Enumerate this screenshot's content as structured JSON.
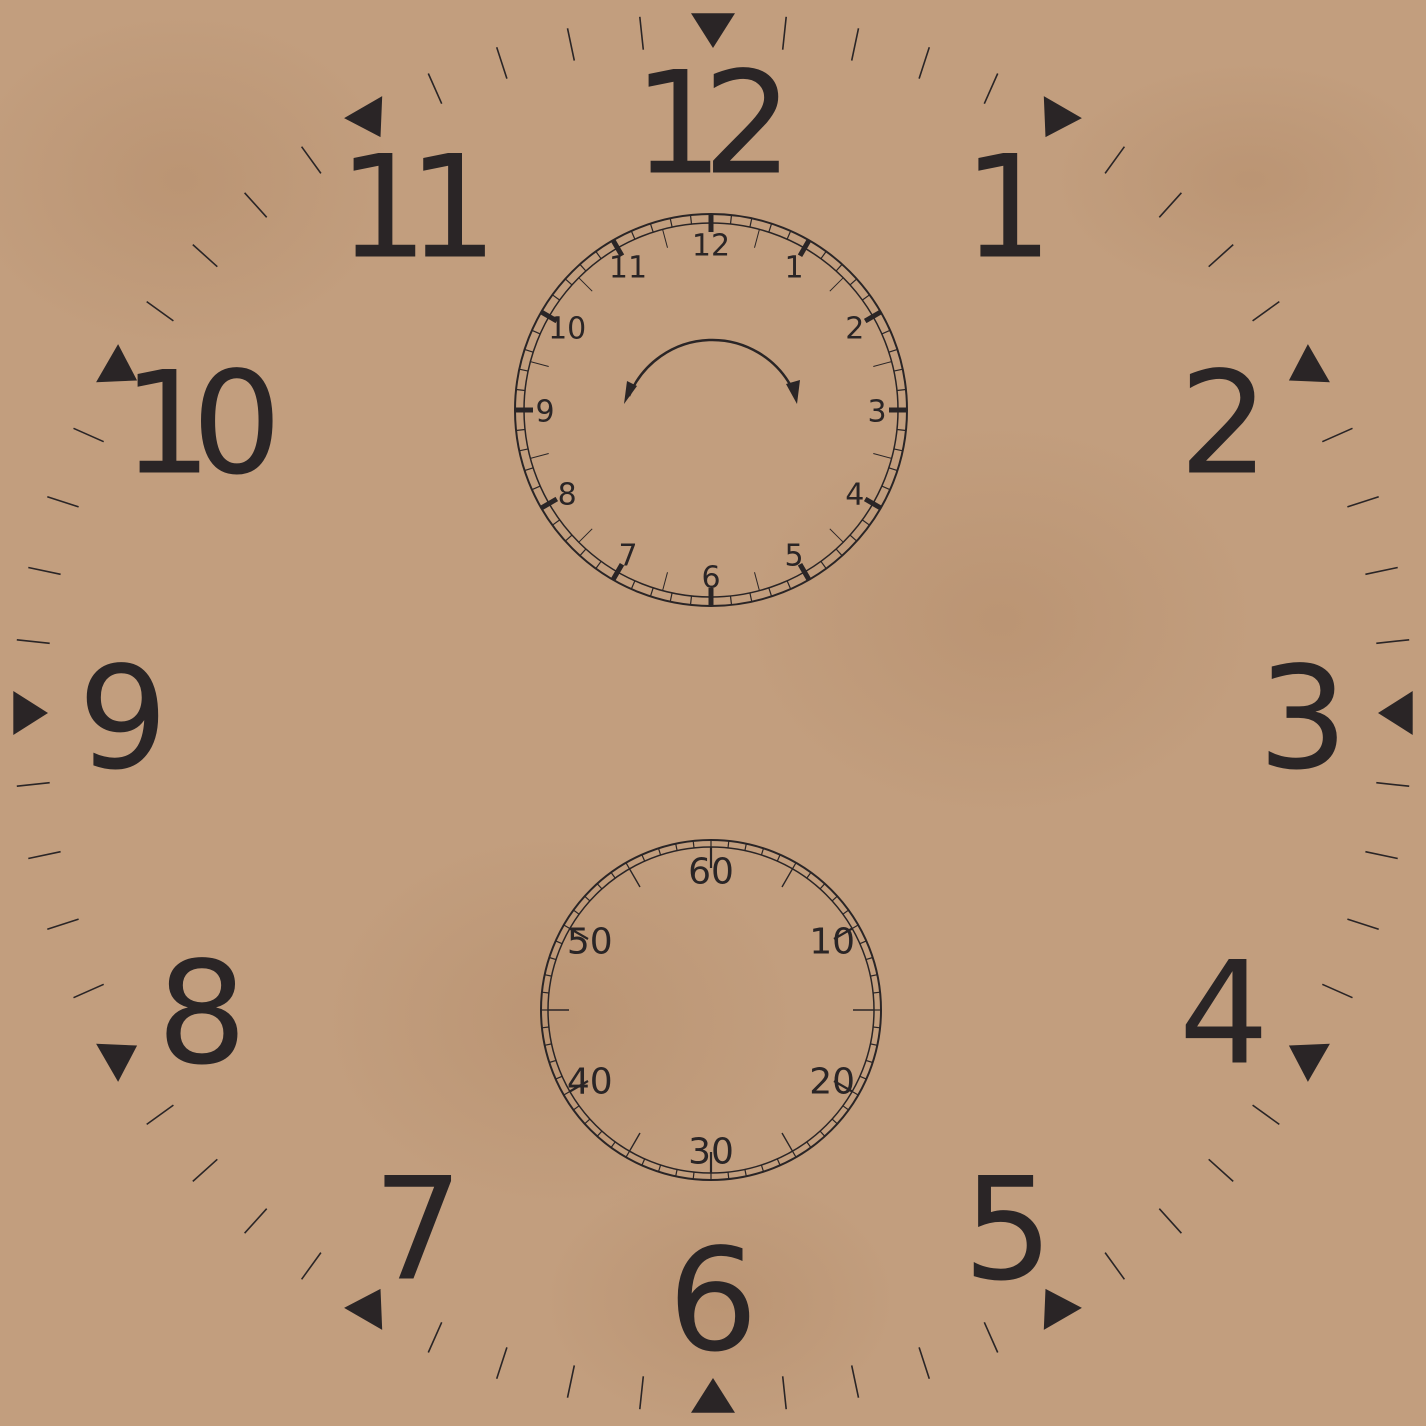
{
  "colors": {
    "background": "#c29e7e",
    "background_stain": "#b8916f",
    "ink": "#2a2526"
  },
  "main_dial": {
    "numerals": [
      "12",
      "1",
      "2",
      "3",
      "4",
      "5",
      "6",
      "7",
      "8",
      "9",
      "10",
      "11"
    ],
    "minute_ticks": 60,
    "marker_icon": "triangle-marker-icon"
  },
  "top_subdial": {
    "numerals": [
      "12",
      "1",
      "2",
      "3",
      "4",
      "5",
      "6",
      "7",
      "8",
      "9",
      "10",
      "11"
    ],
    "minute_ticks": 60,
    "direction_icon": "counterclockwise-arrow-icon"
  },
  "bottom_subdial": {
    "numerals": [
      "60",
      "10",
      "20",
      "30",
      "40",
      "50"
    ],
    "second_ticks": 60
  }
}
